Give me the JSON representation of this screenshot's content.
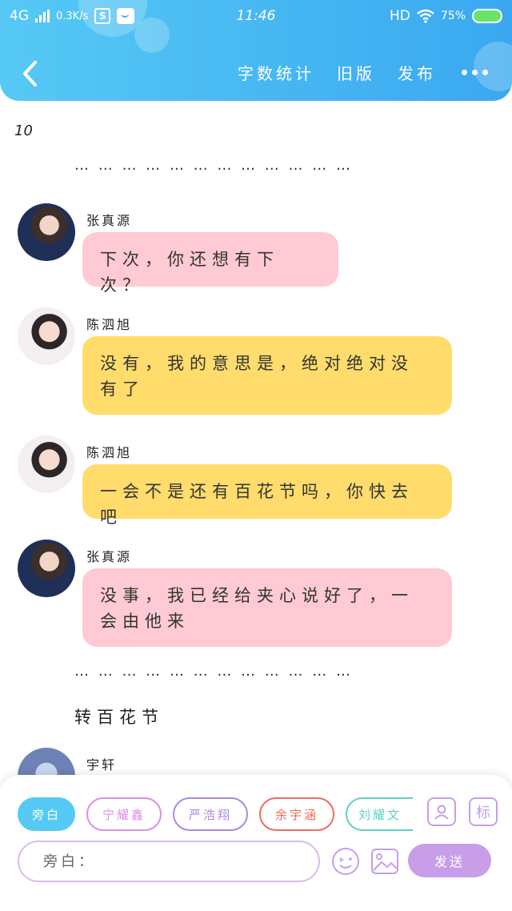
{
  "status_bar": {
    "network": "4G",
    "speed": "0.3K/s",
    "box_label": "S",
    "time": "11:46",
    "hd": "HD",
    "battery": "75%"
  },
  "header": {
    "actions": [
      "字数统计",
      "旧版",
      "发布"
    ]
  },
  "content": {
    "chapter_number": "10",
    "ellipsis_top": "… … … … … … … … … … … …",
    "messages": [
      {
        "speaker": "张真源",
        "text": "下次，你还想有下次？",
        "color": "#ffcad4"
      },
      {
        "speaker": "陈泗旭",
        "text": "没有，我的意思是，绝对绝对没有了",
        "color": "#ffdc6b"
      },
      {
        "speaker": "陈泗旭",
        "text": "一会不是还有百花节吗，你快去吧",
        "color": "#ffdc6b"
      },
      {
        "speaker": "张真源",
        "text": "没事，我已经给夹心说好了，一会由他来",
        "color": "#ffcad4"
      }
    ],
    "ellipsis_bottom": "… … … … … … … … … … … …",
    "narration": "转百花节",
    "partial_speaker": "宇轩"
  },
  "composer": {
    "roles": [
      {
        "label": "旁白",
        "color": "#56c9f5",
        "active": true
      },
      {
        "label": "宁耀鑫",
        "color": "#e08ce6",
        "active": false
      },
      {
        "label": "严浩翔",
        "color": "#a98ae0",
        "active": false
      },
      {
        "label": "余宇涵",
        "color": "#ef6b5f",
        "active": false
      },
      {
        "label": "刘耀文",
        "color": "#5fd1c1",
        "active": false
      }
    ],
    "input_placeholder": "旁白：",
    "send_label": "发送",
    "tag_icon_label": "标"
  }
}
